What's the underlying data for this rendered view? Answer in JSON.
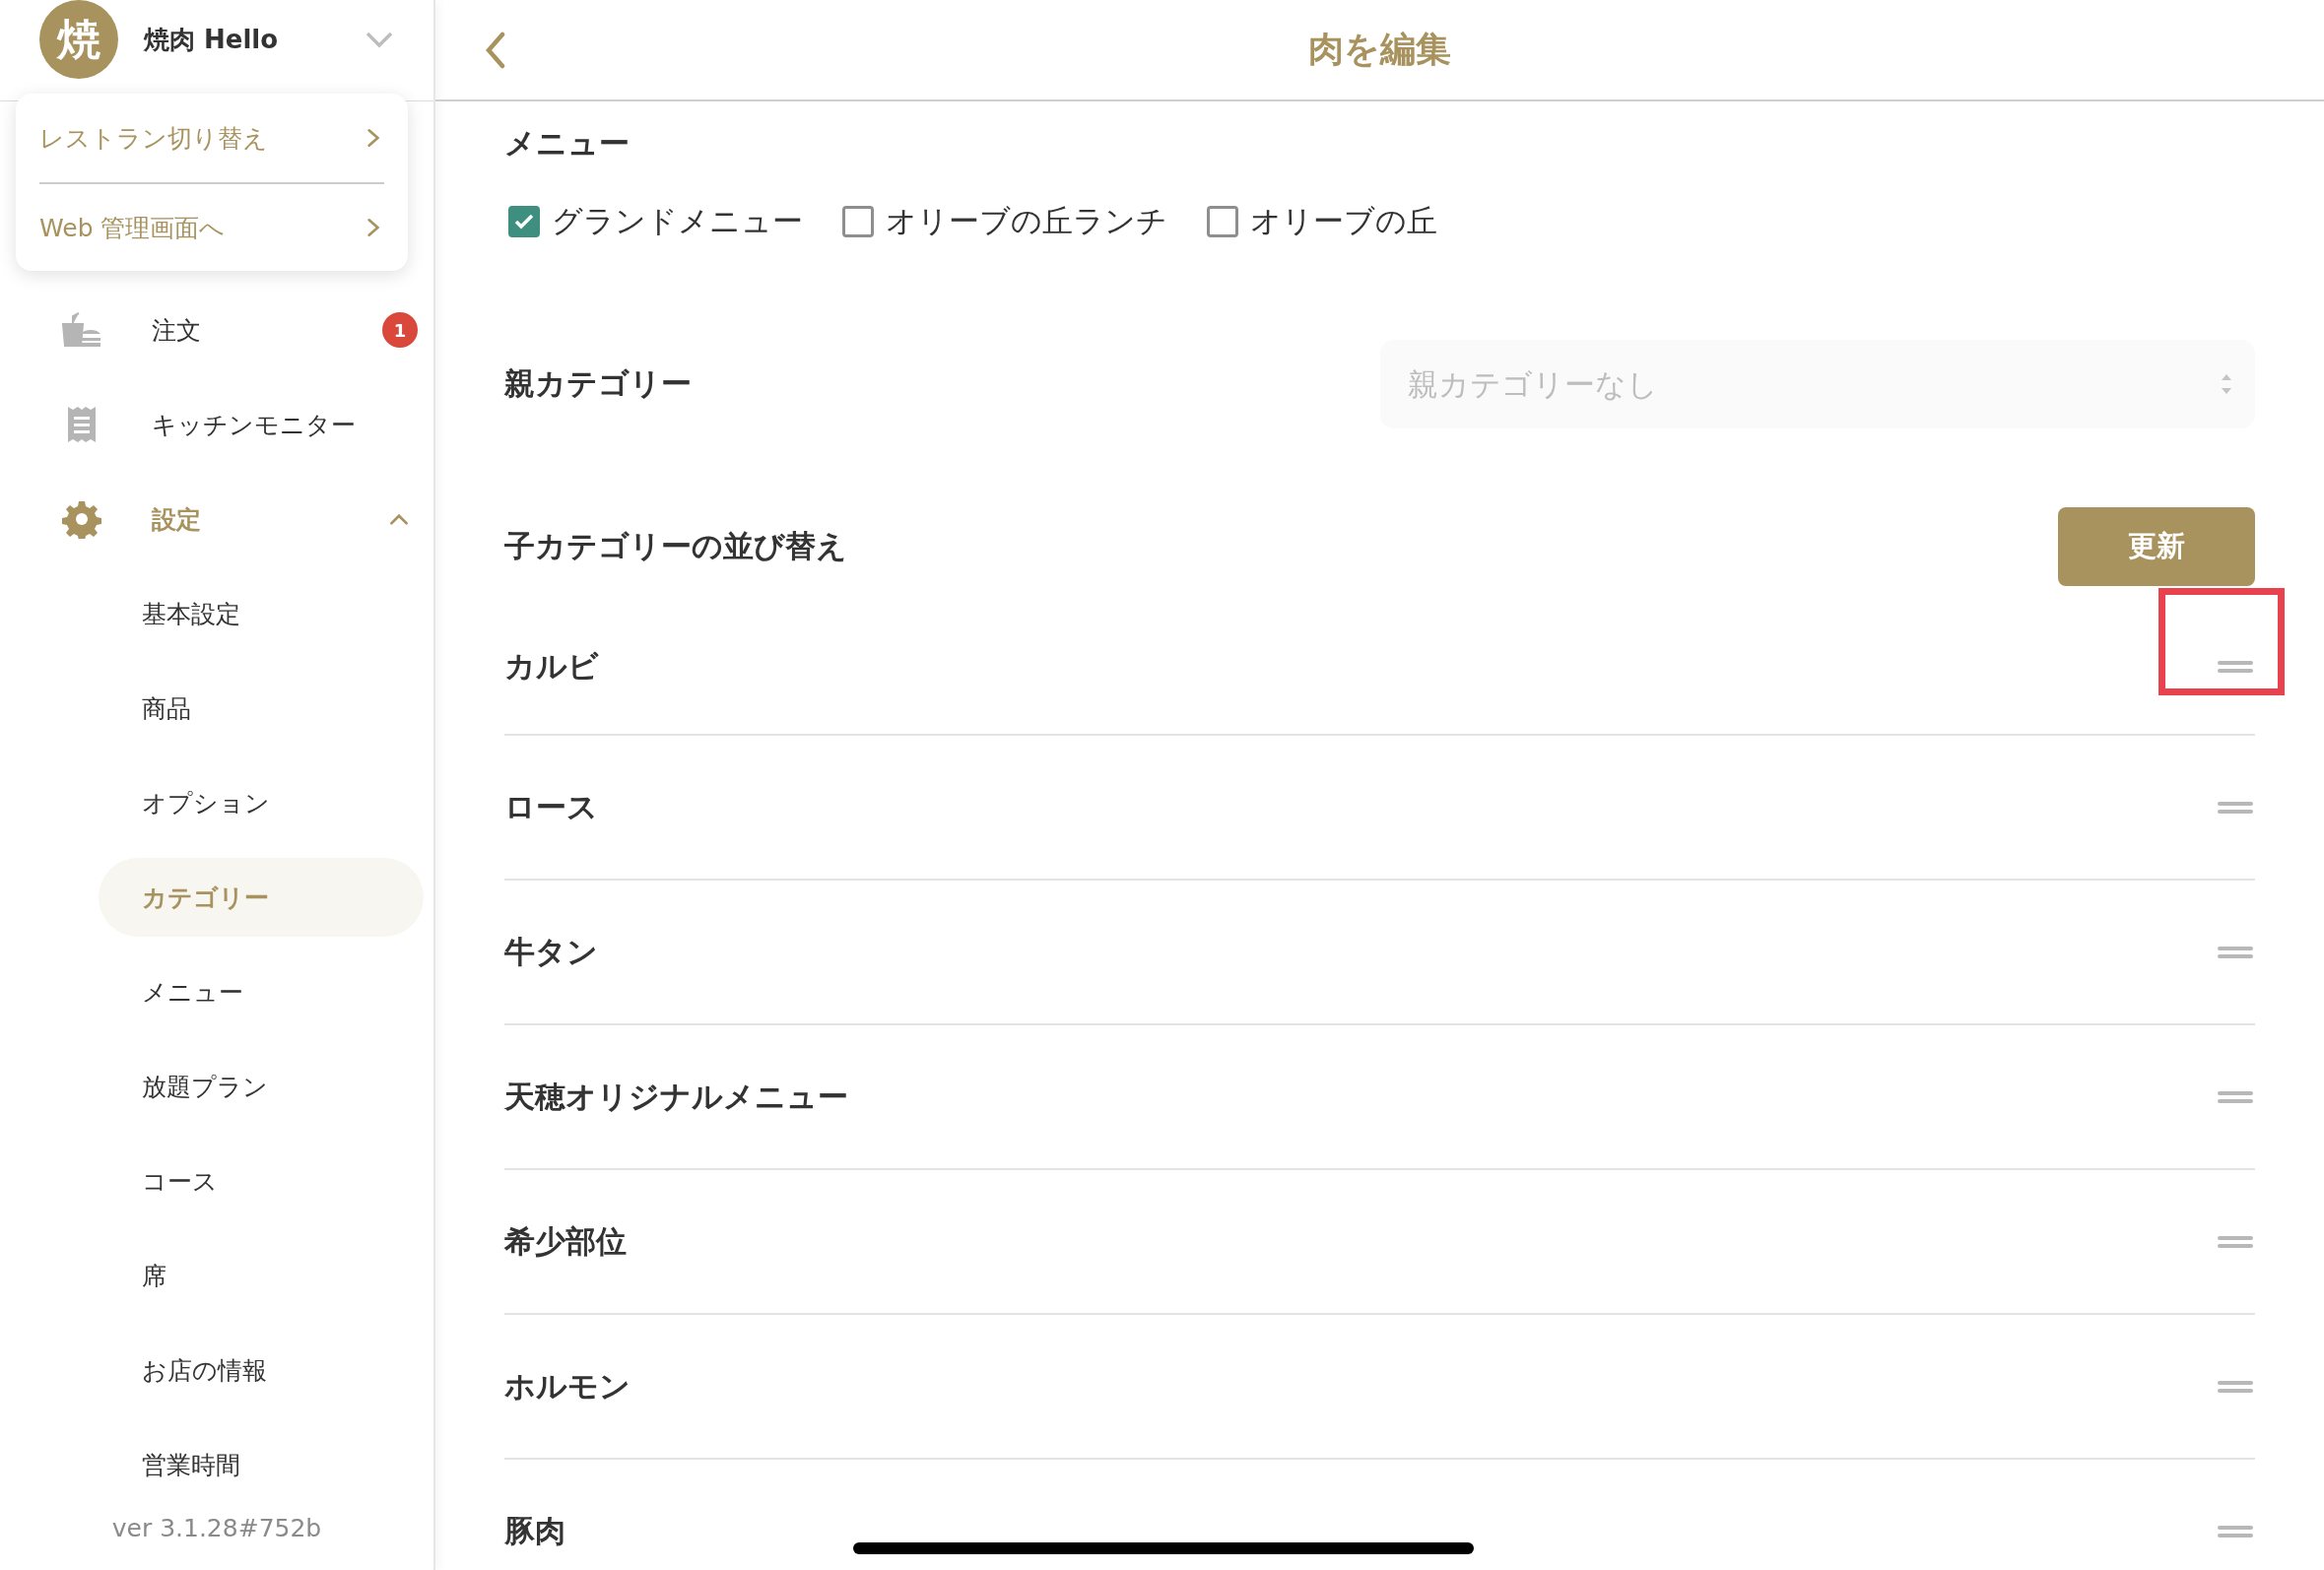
{
  "sidebar": {
    "restaurant": {
      "avatar": "焼",
      "name": "焼肉 Hello"
    },
    "popup": [
      "レストラン切り替え",
      "Web 管理画面へ"
    ],
    "nav": [
      {
        "label": "注文",
        "kind": "orders",
        "badge": "1",
        "selected": false
      },
      {
        "label": "キッチンモニター",
        "kind": "kitchen",
        "selected": false
      },
      {
        "label": "設定",
        "kind": "settings",
        "selected": true,
        "expanded": true,
        "children": [
          {
            "label": "基本設定",
            "selected": false
          },
          {
            "label": "商品",
            "selected": false
          },
          {
            "label": "オプション",
            "selected": false
          },
          {
            "label": "カテゴリー",
            "selected": true
          },
          {
            "label": "メニュー",
            "selected": false
          },
          {
            "label": "放題プラン",
            "selected": false
          },
          {
            "label": "コース",
            "selected": false
          },
          {
            "label": "席",
            "selected": false
          },
          {
            "label": "お店の情報",
            "selected": false
          },
          {
            "label": "営業時間",
            "selected": false
          }
        ]
      }
    ],
    "version": "ver 3.1.28#752b"
  },
  "header": {
    "title": "肉を編集"
  },
  "menu_section": {
    "label": "メニュー",
    "options": [
      {
        "label": "グランドメニュー",
        "checked": true
      },
      {
        "label": "オリーブの丘ランチ",
        "checked": false
      },
      {
        "label": "オリーブの丘",
        "checked": false
      }
    ]
  },
  "parent_category": {
    "label": "親カテゴリー",
    "placeholder": "親カテゴリーなし"
  },
  "sort_section": {
    "label": "子カテゴリーの並び替え",
    "button": "更新"
  },
  "rows": [
    {
      "name": "カルビ",
      "highlighted": true
    },
    {
      "name": "ロース",
      "highlighted": false
    },
    {
      "name": "牛タン",
      "highlighted": false
    },
    {
      "name": "天穂オリジナルメニュー",
      "highlighted": false
    },
    {
      "name": "希少部位",
      "highlighted": false
    },
    {
      "name": "ホルモン",
      "highlighted": false
    },
    {
      "name": "豚肉",
      "highlighted": false
    }
  ]
}
